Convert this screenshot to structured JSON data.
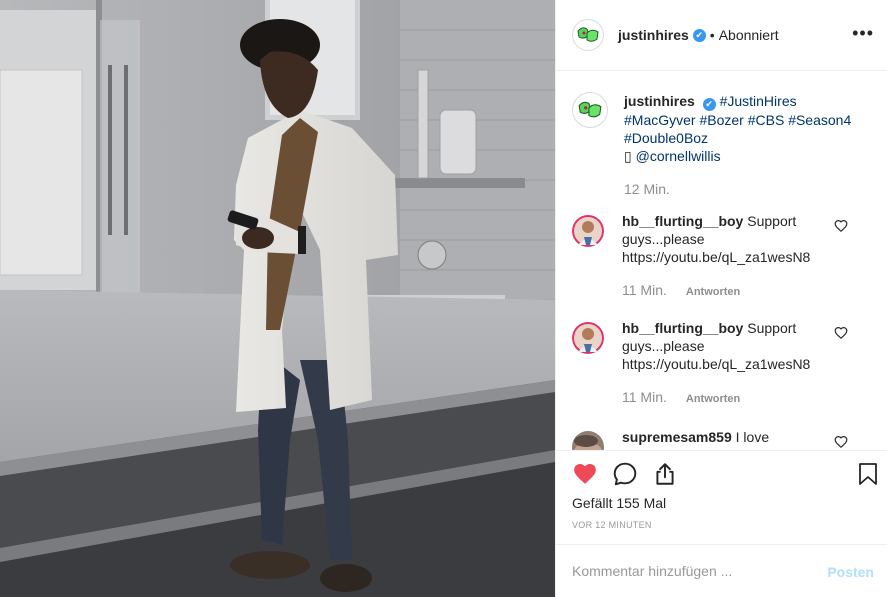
{
  "header": {
    "username": "justinhires",
    "verified_mark": "✔",
    "separator": "•",
    "follow_state": "Abonniert",
    "more_icon": "more-dots-icon"
  },
  "caption": {
    "username": "justinhires",
    "tags": [
      "#JustinHires",
      "#MacGyver",
      "#Bozer",
      "#CBS",
      "#Season4",
      "#Double0Boz"
    ],
    "box_glyph": "▯",
    "mention": "@cornellwillis",
    "time": "12 Min."
  },
  "comments": [
    {
      "username": "hb__flurting__boy",
      "text": "Support guys...please https://youtu.be/qL_za1wesN8",
      "time": "11 Min.",
      "reply_label": "Antworten"
    },
    {
      "username": "hb__flurting__boy",
      "text": "Support guys...please https://youtu.be/qL_za1wesN8",
      "time": "11 Min.",
      "reply_label": "Antworten"
    },
    {
      "username": "supremesam859",
      "text": "I love youuuuuuuuuu love the show!",
      "time": "",
      "reply_label": ""
    }
  ],
  "actions": {
    "like_icon": "heart-filled-icon",
    "comment_icon": "comment-bubble-icon",
    "share_icon": "share-icon",
    "save_icon": "bookmark-icon",
    "like_color": "#ed4956",
    "likes_text": "Gefällt 155 Mal",
    "timestamp": "VOR 12 MINUTEN"
  },
  "add_comment": {
    "placeholder": "Kommentar hinzufügen ...",
    "post_label": "Posten",
    "post_color": "#b2dffc"
  },
  "colors": {
    "link": "#003569",
    "verified": "#3897f0",
    "muted": "#8e8e8e",
    "text": "#262626"
  }
}
